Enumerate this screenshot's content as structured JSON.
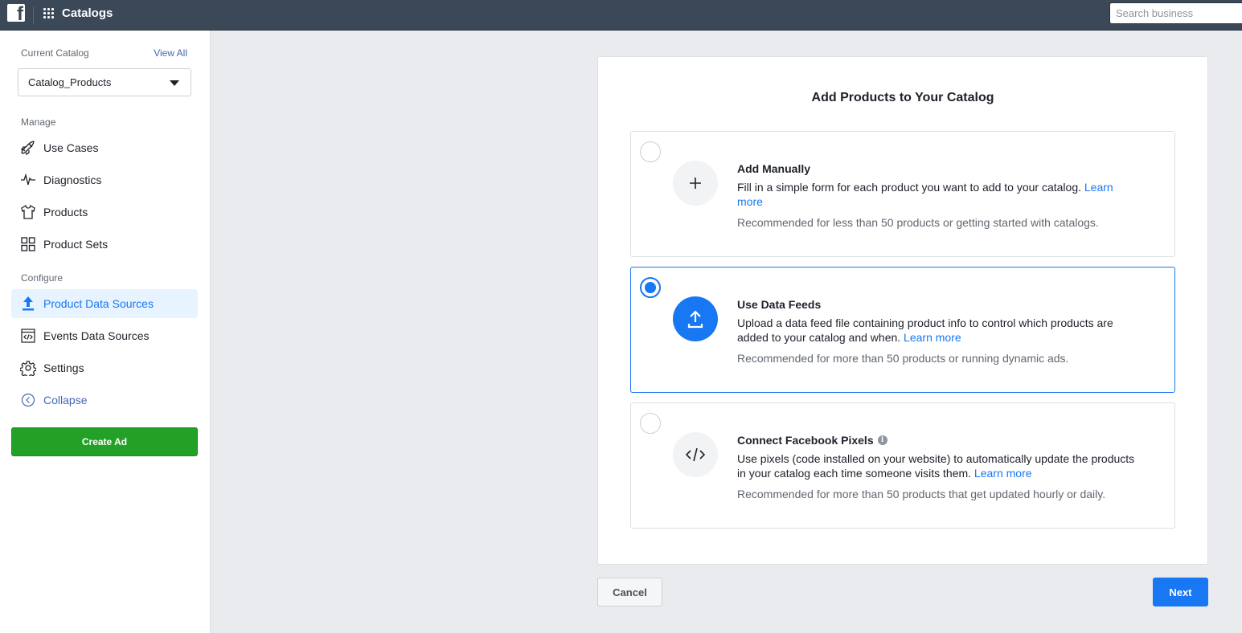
{
  "topbar": {
    "logo_letter": "f",
    "app_title": "Catalogs",
    "search_placeholder": "Search business"
  },
  "sidebar": {
    "current_catalog_label": "Current Catalog",
    "view_all_label": "View All",
    "catalog_selected": "Catalog_Products",
    "manage_label": "Manage",
    "manage_items": [
      {
        "label": "Use Cases",
        "icon": "rocket-icon"
      },
      {
        "label": "Diagnostics",
        "icon": "pulse-icon"
      },
      {
        "label": "Products",
        "icon": "shirt-icon"
      },
      {
        "label": "Product Sets",
        "icon": "grid-icon"
      }
    ],
    "configure_label": "Configure",
    "configure_items": [
      {
        "label": "Product Data Sources",
        "icon": "upload-icon",
        "active": true
      },
      {
        "label": "Events Data Sources",
        "icon": "code-window-icon"
      },
      {
        "label": "Settings",
        "icon": "gear-icon"
      }
    ],
    "collapse_label": "Collapse",
    "create_ad_label": "Create Ad"
  },
  "main": {
    "title": "Add Products to Your Catalog",
    "options": [
      {
        "title": "Add Manually",
        "description": "Fill in a simple form for each product you want to add to your catalog.",
        "link": "Learn more",
        "recommendation": "Recommended for less than 50 products or getting started with catalogs.",
        "selected": false,
        "icon": "plus-icon"
      },
      {
        "title": "Use Data Feeds",
        "description": "Upload a data feed file containing product info to control which products are added to your catalog and when.",
        "link": "Learn more",
        "recommendation": "Recommended for more than 50 products or running dynamic ads.",
        "selected": true,
        "icon": "upload-icon"
      },
      {
        "title": "Connect Facebook Pixels",
        "description": "Use pixels (code installed on your website) to automatically update the products in your catalog each time someone visits them.",
        "link": "Learn more",
        "recommendation": "Recommended for more than 50 products that get updated hourly or daily.",
        "selected": false,
        "icon": "code-icon"
      }
    ],
    "cancel_label": "Cancel",
    "next_label": "Next"
  },
  "colors": {
    "topbar": "#3b4858",
    "accent": "#1877f2",
    "create_ad": "#23a127"
  }
}
